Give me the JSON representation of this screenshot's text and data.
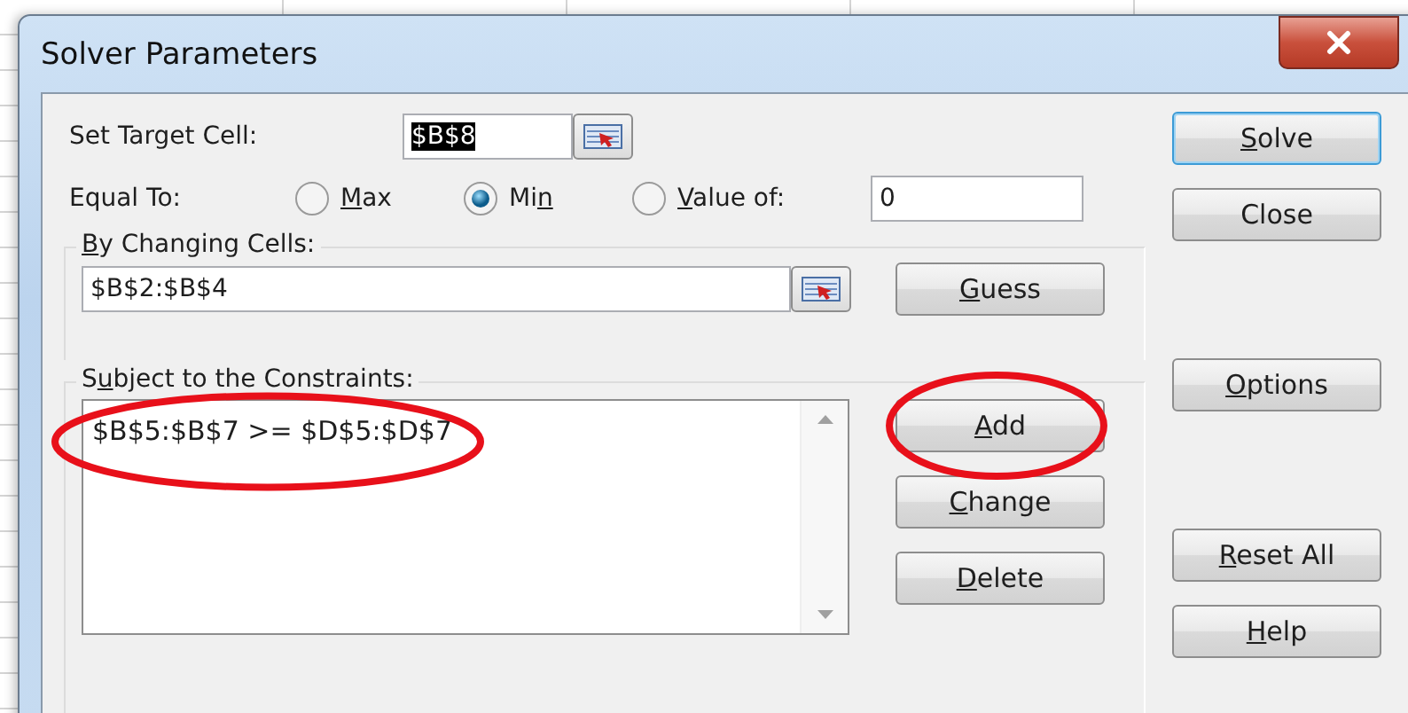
{
  "window": {
    "title": "Solver Parameters"
  },
  "target_cell": {
    "label": "Set Target Cell:",
    "value": "$B$8",
    "value_selected": true
  },
  "equal_to": {
    "label": "Equal To:",
    "options": [
      {
        "label": {
          "key": "M",
          "after": "ax"
        },
        "selected": false
      },
      {
        "label": {
          "before": "Mi",
          "key": "n"
        },
        "selected": true
      },
      {
        "label": {
          "key": "V",
          "after": "alue of:"
        },
        "selected": false
      }
    ],
    "value_of": "0"
  },
  "changing_cells": {
    "label": {
      "key": "B",
      "after": "y Changing Cells:"
    },
    "value": "$B$2:$B$4",
    "guess_button": {
      "label": {
        "key": "G",
        "after": "uess"
      }
    }
  },
  "constraints": {
    "label": {
      "before": "S",
      "key": "u",
      "after": "bject to the Constraints:"
    },
    "items": [
      {
        "text": "$B$5:$B$7 >= $D$5:$D$7",
        "circled": true
      }
    ],
    "buttons": [
      {
        "label": {
          "key": "A",
          "after": "dd"
        },
        "circled": true
      },
      {
        "label": {
          "key": "C",
          "after": "hange"
        },
        "circled": false
      },
      {
        "label": {
          "key": "D",
          "after": "elete"
        },
        "circled": false
      }
    ]
  },
  "side_button_groups": [
    [
      {
        "label": {
          "key": "S",
          "after": "olve"
        },
        "default": true
      },
      {
        "label": {
          "before": "Close"
        },
        "default": false
      }
    ],
    [
      {
        "label": {
          "key": "O",
          "after": "ptions"
        },
        "default": false
      }
    ],
    [
      {
        "label": {
          "key": "R",
          "after": "eset All"
        },
        "default": false
      },
      {
        "label": {
          "key": "H",
          "after": "elp"
        },
        "default": false
      }
    ]
  ]
}
